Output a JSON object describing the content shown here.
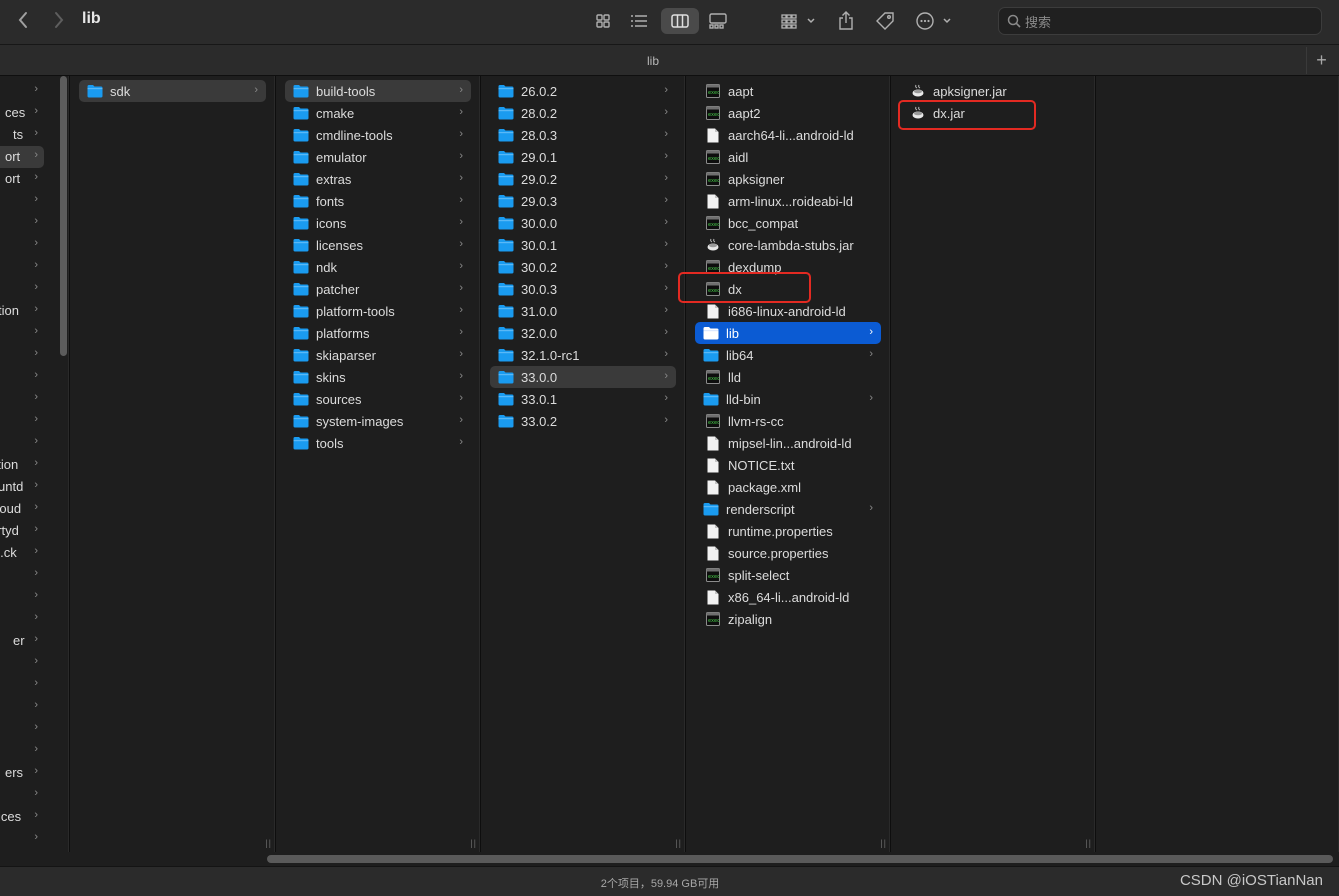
{
  "window": {
    "title": "lib"
  },
  "toolbar": {
    "back_icon": "chevron-left-icon",
    "forward_icon": "chevron-right-icon",
    "view_icons": [
      "icon-view-icon",
      "list-view-icon",
      "column-view-icon",
      "gallery-view-icon"
    ],
    "active_view": "column-view-icon",
    "search_placeholder": "搜索"
  },
  "tab": {
    "label": "lib",
    "new_tab_label": "+"
  },
  "sidebar_partial": {
    "labels": [
      "ces",
      "ts",
      "ort",
      "ort",
      "tion",
      "ation",
      "untd",
      "cloud",
      "artyd",
      "al.ck",
      "er",
      "ers",
      "ices"
    ]
  },
  "columns": [
    {
      "name": "col-root",
      "items": [
        {
          "label": "sdk",
          "type": "folder",
          "chevron": true,
          "selected": "gray"
        }
      ]
    },
    {
      "name": "col-sdk",
      "items": [
        {
          "label": "build-tools",
          "type": "folder",
          "chevron": true,
          "selected": "gray"
        },
        {
          "label": "cmake",
          "type": "folder",
          "chevron": true
        },
        {
          "label": "cmdline-tools",
          "type": "folder",
          "chevron": true
        },
        {
          "label": "emulator",
          "type": "folder",
          "chevron": true
        },
        {
          "label": "extras",
          "type": "folder",
          "chevron": true
        },
        {
          "label": "fonts",
          "type": "folder",
          "chevron": true
        },
        {
          "label": "icons",
          "type": "folder",
          "chevron": true
        },
        {
          "label": "licenses",
          "type": "folder",
          "chevron": true
        },
        {
          "label": "ndk",
          "type": "folder",
          "chevron": true
        },
        {
          "label": "patcher",
          "type": "folder",
          "chevron": true
        },
        {
          "label": "platform-tools",
          "type": "folder",
          "chevron": true
        },
        {
          "label": "platforms",
          "type": "folder",
          "chevron": true
        },
        {
          "label": "skiaparser",
          "type": "folder",
          "chevron": true
        },
        {
          "label": "skins",
          "type": "folder",
          "chevron": true
        },
        {
          "label": "sources",
          "type": "folder",
          "chevron": true
        },
        {
          "label": "system-images",
          "type": "folder",
          "chevron": true
        },
        {
          "label": "tools",
          "type": "folder",
          "chevron": true
        }
      ]
    },
    {
      "name": "col-build-tools",
      "items": [
        {
          "label": "26.0.2",
          "type": "folder",
          "chevron": true
        },
        {
          "label": "28.0.2",
          "type": "folder",
          "chevron": true
        },
        {
          "label": "28.0.3",
          "type": "folder",
          "chevron": true
        },
        {
          "label": "29.0.1",
          "type": "folder",
          "chevron": true
        },
        {
          "label": "29.0.2",
          "type": "folder",
          "chevron": true
        },
        {
          "label": "29.0.3",
          "type": "folder",
          "chevron": true
        },
        {
          "label": "30.0.0",
          "type": "folder",
          "chevron": true
        },
        {
          "label": "30.0.1",
          "type": "folder",
          "chevron": true
        },
        {
          "label": "30.0.2",
          "type": "folder",
          "chevron": true
        },
        {
          "label": "30.0.3",
          "type": "folder",
          "chevron": true
        },
        {
          "label": "31.0.0",
          "type": "folder",
          "chevron": true
        },
        {
          "label": "32.0.0",
          "type": "folder",
          "chevron": true
        },
        {
          "label": "32.1.0-rc1",
          "type": "folder",
          "chevron": true
        },
        {
          "label": "33.0.0",
          "type": "folder",
          "chevron": true,
          "selected": "gray"
        },
        {
          "label": "33.0.1",
          "type": "folder",
          "chevron": true
        },
        {
          "label": "33.0.2",
          "type": "folder",
          "chevron": true
        }
      ]
    },
    {
      "name": "col-33-0-0",
      "items": [
        {
          "label": "aapt",
          "type": "exec"
        },
        {
          "label": "aapt2",
          "type": "exec"
        },
        {
          "label": "aarch64-li...android-ld",
          "type": "doc"
        },
        {
          "label": "aidl",
          "type": "exec"
        },
        {
          "label": "apksigner",
          "type": "exec"
        },
        {
          "label": "arm-linux...roideabi-ld",
          "type": "doc"
        },
        {
          "label": "bcc_compat",
          "type": "exec"
        },
        {
          "label": "core-lambda-stubs.jar",
          "type": "jar"
        },
        {
          "label": "dexdump",
          "type": "exec"
        },
        {
          "label": "dx",
          "type": "exec",
          "highlighted": true
        },
        {
          "label": "i686-linux-android-ld",
          "type": "doc"
        },
        {
          "label": "lib",
          "type": "folder",
          "chevron": true,
          "selected": "blue"
        },
        {
          "label": "lib64",
          "type": "folder",
          "chevron": true
        },
        {
          "label": "lld",
          "type": "exec"
        },
        {
          "label": "lld-bin",
          "type": "folder",
          "chevron": true
        },
        {
          "label": "llvm-rs-cc",
          "type": "exec"
        },
        {
          "label": "mipsel-lin...android-ld",
          "type": "doc"
        },
        {
          "label": "NOTICE.txt",
          "type": "doc"
        },
        {
          "label": "package.xml",
          "type": "doc"
        },
        {
          "label": "renderscript",
          "type": "folder",
          "chevron": true
        },
        {
          "label": "runtime.properties",
          "type": "doc"
        },
        {
          "label": "source.properties",
          "type": "doc"
        },
        {
          "label": "split-select",
          "type": "exec"
        },
        {
          "label": "x86_64-li...android-ld",
          "type": "doc"
        },
        {
          "label": "zipalign",
          "type": "exec"
        }
      ]
    },
    {
      "name": "col-lib",
      "items": [
        {
          "label": "apksigner.jar",
          "type": "jar"
        },
        {
          "label": "dx.jar",
          "type": "jar",
          "highlighted": true
        }
      ]
    }
  ],
  "status": {
    "text": "2个项目，59.94 GB可用"
  },
  "watermark": "CSDN @iOSTianNan",
  "colors": {
    "folder": "#1a9bf0",
    "selection_blue": "#0b5bd3",
    "highlight_red": "#e32a22"
  }
}
